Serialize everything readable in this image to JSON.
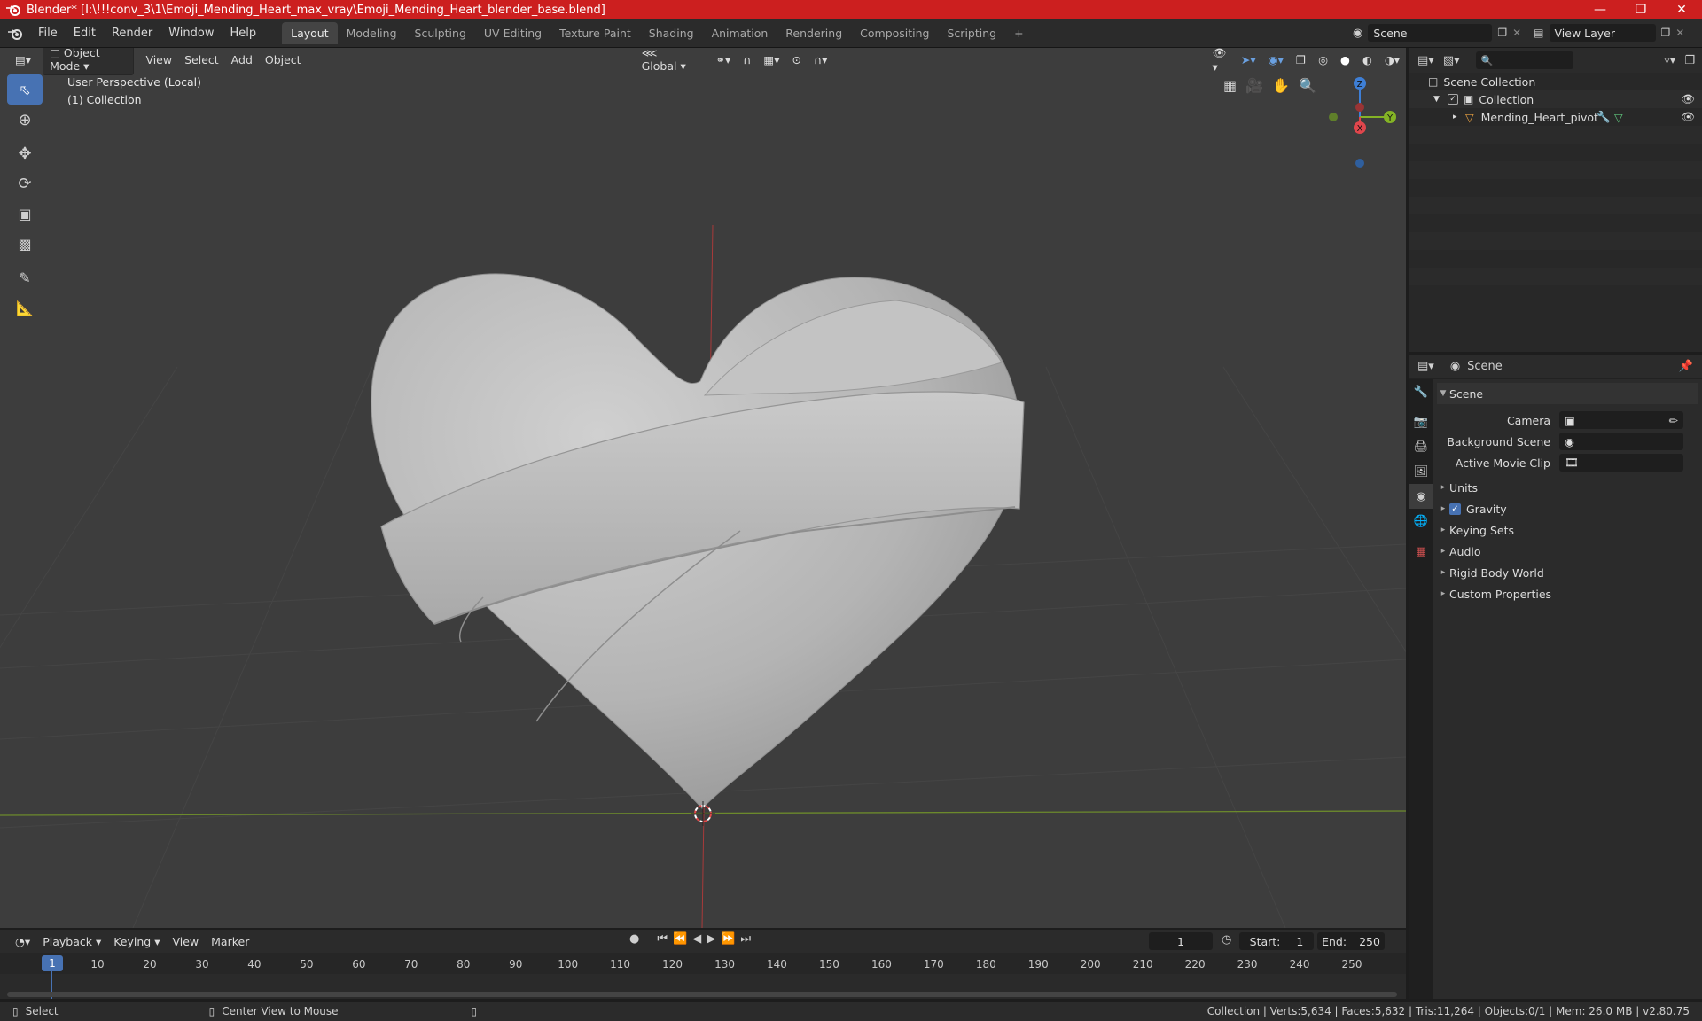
{
  "window": {
    "title": "Blender* [I:\\!!!conv_3\\1\\Emoji_Mending_Heart_max_vray\\Emoji_Mending_Heart_blender_base.blend]"
  },
  "menus": [
    "File",
    "Edit",
    "Render",
    "Window",
    "Help"
  ],
  "workspaces": [
    "Layout",
    "Modeling",
    "Sculpting",
    "UV Editing",
    "Texture Paint",
    "Shading",
    "Animation",
    "Rendering",
    "Compositing",
    "Scripting"
  ],
  "active_workspace": "Layout",
  "scene_field": "Scene",
  "view_layer_field": "View Layer",
  "viewport": {
    "mode": "Object Mode",
    "menus": [
      "View",
      "Select",
      "Add",
      "Object"
    ],
    "transform_orientation": "Global",
    "perspective_label": "User Perspective (Local)",
    "collection_label": "(1) Collection",
    "gizmo": {
      "z": "Z",
      "y": "Y",
      "x": "X"
    }
  },
  "outliner": {
    "root": "Scene Collection",
    "collection": "Collection",
    "object": "Mending_Heart_pivot"
  },
  "properties": {
    "header": "Scene",
    "panel": "Scene",
    "fields": [
      {
        "label": "Camera"
      },
      {
        "label": "Background Scene"
      },
      {
        "label": "Active Movie Clip"
      }
    ],
    "sections": [
      "Units",
      "Gravity",
      "Keying Sets",
      "Audio",
      "Rigid Body World",
      "Custom Properties"
    ],
    "gravity_checked": true
  },
  "timeline": {
    "menus": [
      "Playback",
      "Keying",
      "View",
      "Marker"
    ],
    "current_frame": "1",
    "start_label": "Start:",
    "start": "1",
    "end_label": "End:",
    "end": "250",
    "ticks": [
      "1",
      "10",
      "20",
      "30",
      "40",
      "50",
      "60",
      "70",
      "80",
      "90",
      "100",
      "110",
      "120",
      "130",
      "140",
      "150",
      "160",
      "170",
      "180",
      "190",
      "200",
      "210",
      "220",
      "230",
      "240",
      "250"
    ]
  },
  "statusbar": {
    "left1": "Select",
    "left2": "Center View to Mouse",
    "right": "Collection | Verts:5,634 | Faces:5,632 | Tris:11,264 | Objects:0/1 | Mem: 26.0 MB | v2.80.75"
  },
  "colors": {
    "title_bar": "#cc1f1f",
    "accent": "#4772b3",
    "x_axis": "#e0464c",
    "y_axis": "#84b325",
    "z_axis": "#3e7fd6"
  }
}
